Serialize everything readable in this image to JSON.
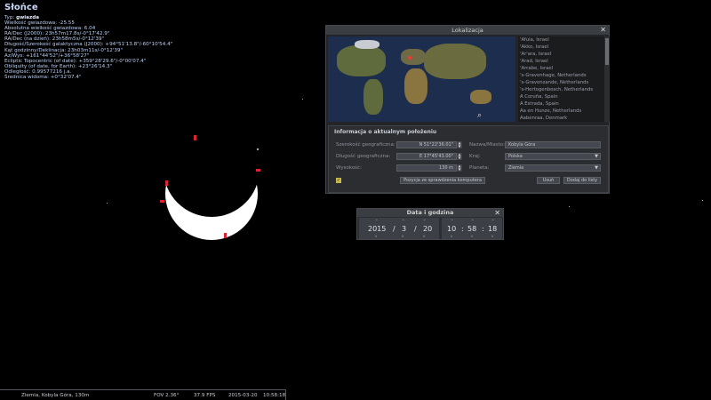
{
  "object_info": {
    "title": "Słońce",
    "type_label": "Typ:",
    "type_value": "gwiazda",
    "lines": [
      "Wielkość gwiazdowa: -25.55",
      "Absolutna wielkość gwiazdowa: 6.04",
      "RA/Dec (J2000): 23h57m17.8s/-0°17'42.9\"",
      "RA/Dec (na dzień): 23h58m5s/-0°12'39\"",
      "Długość/Szerokość galaktyczna (J2000): +94°51'13.8\"/-60°10'54.4\"",
      "Kąt godzinny/Deklinacja: 23h03m11s/-0°12'39\"",
      "Az/Wys: +161°44'52\"/+36°58'27\"",
      "Ecliptic Topocentric (of date): +359°28'29.6\"/-0°00'07.4\"",
      "Obliquity (of date, for Earth): +23°26'14.3\"",
      "Odległość: 0.99577216 j.a.",
      "Średnica widoma: +0°32'07.4\""
    ]
  },
  "location_window": {
    "title": "Lokalizacja",
    "close_icon": "close-icon",
    "cities": [
      "'Afula, Israel",
      "'Akko, Israel",
      "'Ar'ara, Israel",
      "'Arad, Israel",
      "'Arrabe, Israel",
      "'s-Gravenhage, Netherlands",
      "'s-Gravenzande, Netherlands",
      "'s-Hertogenbosch, Netherlands",
      "A Coruña, Spain",
      "A Estrada, Spain",
      "Aa en Hunze, Netherlands",
      "Aabenraa, Denmark"
    ],
    "current": {
      "header": "Informacja o aktualnym położeniu",
      "lat_label": "Szerokość geograficzna:",
      "lat_value": "N 51°22'36.01\"",
      "lon_label": "Długość geograficzna:",
      "lon_value": "E 17°45'43.00\"",
      "alt_label": "Wysokość:",
      "alt_value": "130 m",
      "name_label": "Nazwa/Miasto:",
      "name_value": "Kobyla Góra",
      "country_label": "Kraj:",
      "country_value": "Polska",
      "planet_label": "Planeta:",
      "planet_value": "Ziemia",
      "locate_button": "Pozycja ze sprawdzenia komputera",
      "delete_button": "Usuń",
      "add_button": "Dodaj do listy"
    }
  },
  "date_window": {
    "title": "Data i godzina",
    "year": "2015",
    "month": "3",
    "day": "20",
    "hour": "10",
    "minute": "58",
    "second": "18",
    "sep_date": "/",
    "sep_time": ":"
  },
  "status_bar": {
    "location": "Ziemia, Kobyla Góra, 130m",
    "fov": "FOV 2.36°",
    "fps": "37.9 FPS",
    "date": "2015-03-20",
    "time": "10:58:18"
  },
  "colors": {
    "sun": "#ffffff",
    "background": "#000000"
  }
}
